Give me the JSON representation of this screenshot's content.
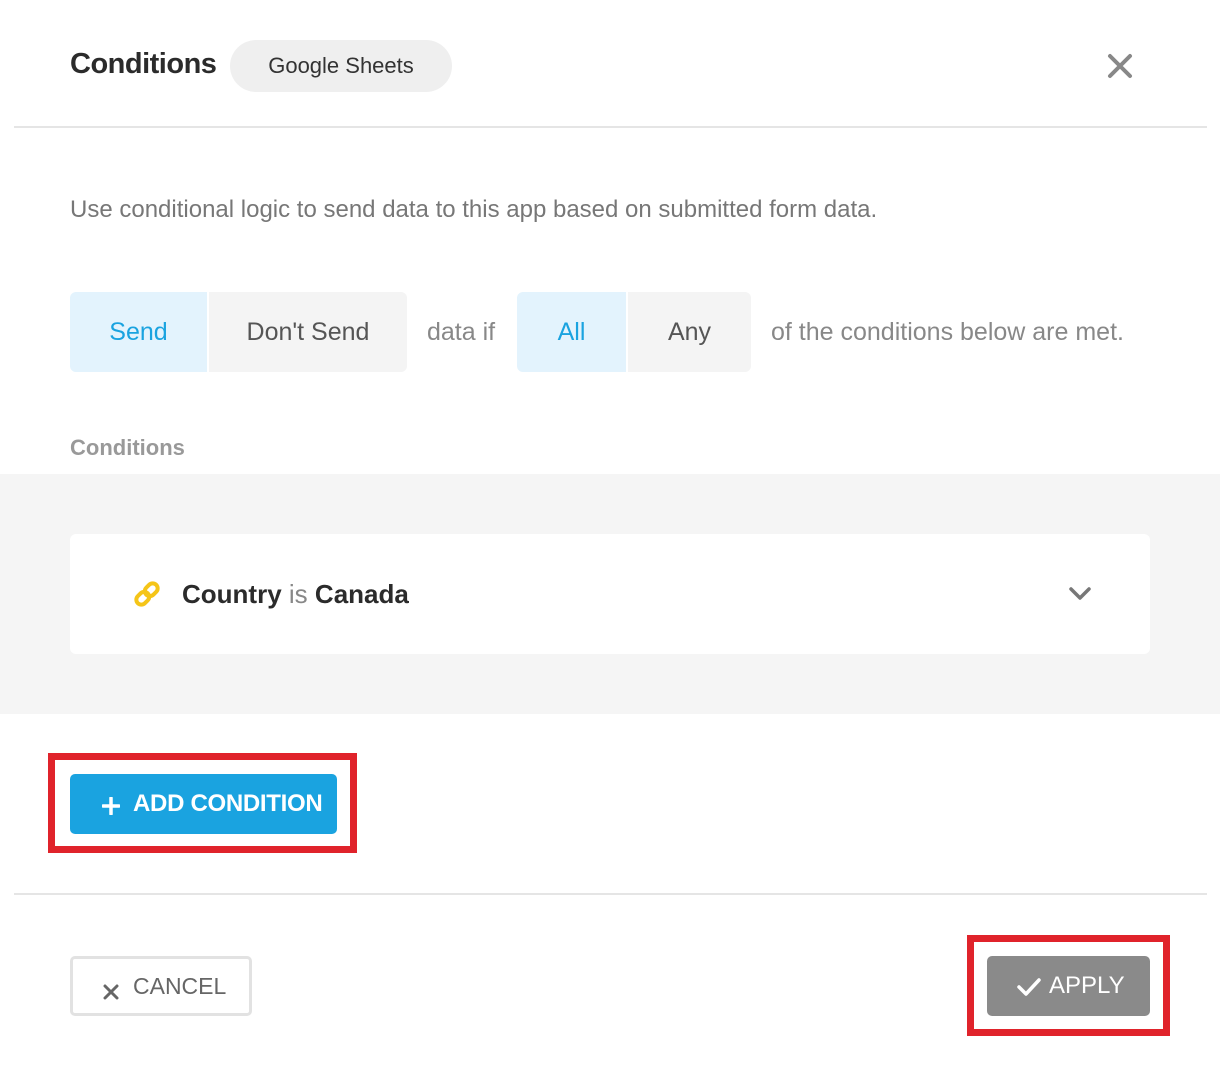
{
  "header": {
    "title": "Conditions",
    "app_name": "Google Sheets"
  },
  "description": "Use conditional logic to send data to this app based on submitted form data.",
  "logic": {
    "action_options": [
      {
        "label": "Send",
        "selected": true
      },
      {
        "label": "Don't Send",
        "selected": false
      }
    ],
    "middle_text": "data if",
    "match_options": [
      {
        "label": "All",
        "selected": true
      },
      {
        "label": "Any",
        "selected": false
      }
    ],
    "trailing_text": "of the conditions below are met."
  },
  "conditions_section": {
    "label": "Conditions",
    "items": [
      {
        "field": "Country",
        "operator": "is",
        "value": "Canada",
        "icon": "link-icon"
      }
    ]
  },
  "buttons": {
    "add_condition": "ADD CONDITION",
    "cancel": "CANCEL",
    "apply": "APPLY"
  },
  "colors": {
    "accent": "#1aa3e0",
    "accent_light": "#e3f3fd",
    "apply_disabled": "#8a8a8a",
    "highlight": "#e0232b",
    "link_icon": "#f5c518"
  }
}
